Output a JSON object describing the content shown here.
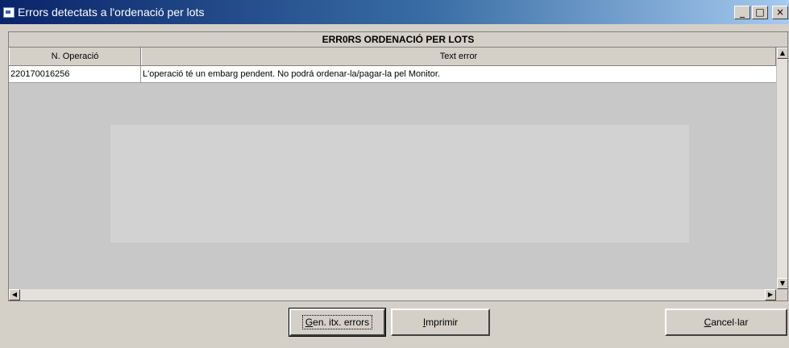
{
  "window": {
    "title": "Errors detectats a l'ordenació per lots",
    "controls": {
      "minimize": "_",
      "maximize": "□",
      "close": "×"
    }
  },
  "grid": {
    "caption": "ERR0RS ORDENACIÓ PER LOTS",
    "columns": [
      "N. Operació",
      "Text error"
    ],
    "rows": [
      [
        "220170016256",
        "L'operació té un embarg pendent. No podrá ordenar-la/pagar-la pel Monitor."
      ]
    ]
  },
  "buttons": {
    "generate": {
      "accel": "G",
      "rest": "en. itx. errors"
    },
    "print": {
      "accel": "I",
      "rest": "mprimir"
    },
    "cancel": {
      "accel": "C",
      "rest": "ancel·lar"
    }
  },
  "icons": {
    "app": "app-window-icon",
    "scroll_up": "scroll-up-arrow",
    "scroll_down": "scroll-down-arrow",
    "scroll_left": "scroll-left-arrow",
    "scroll_right": "scroll-right-arrow"
  }
}
